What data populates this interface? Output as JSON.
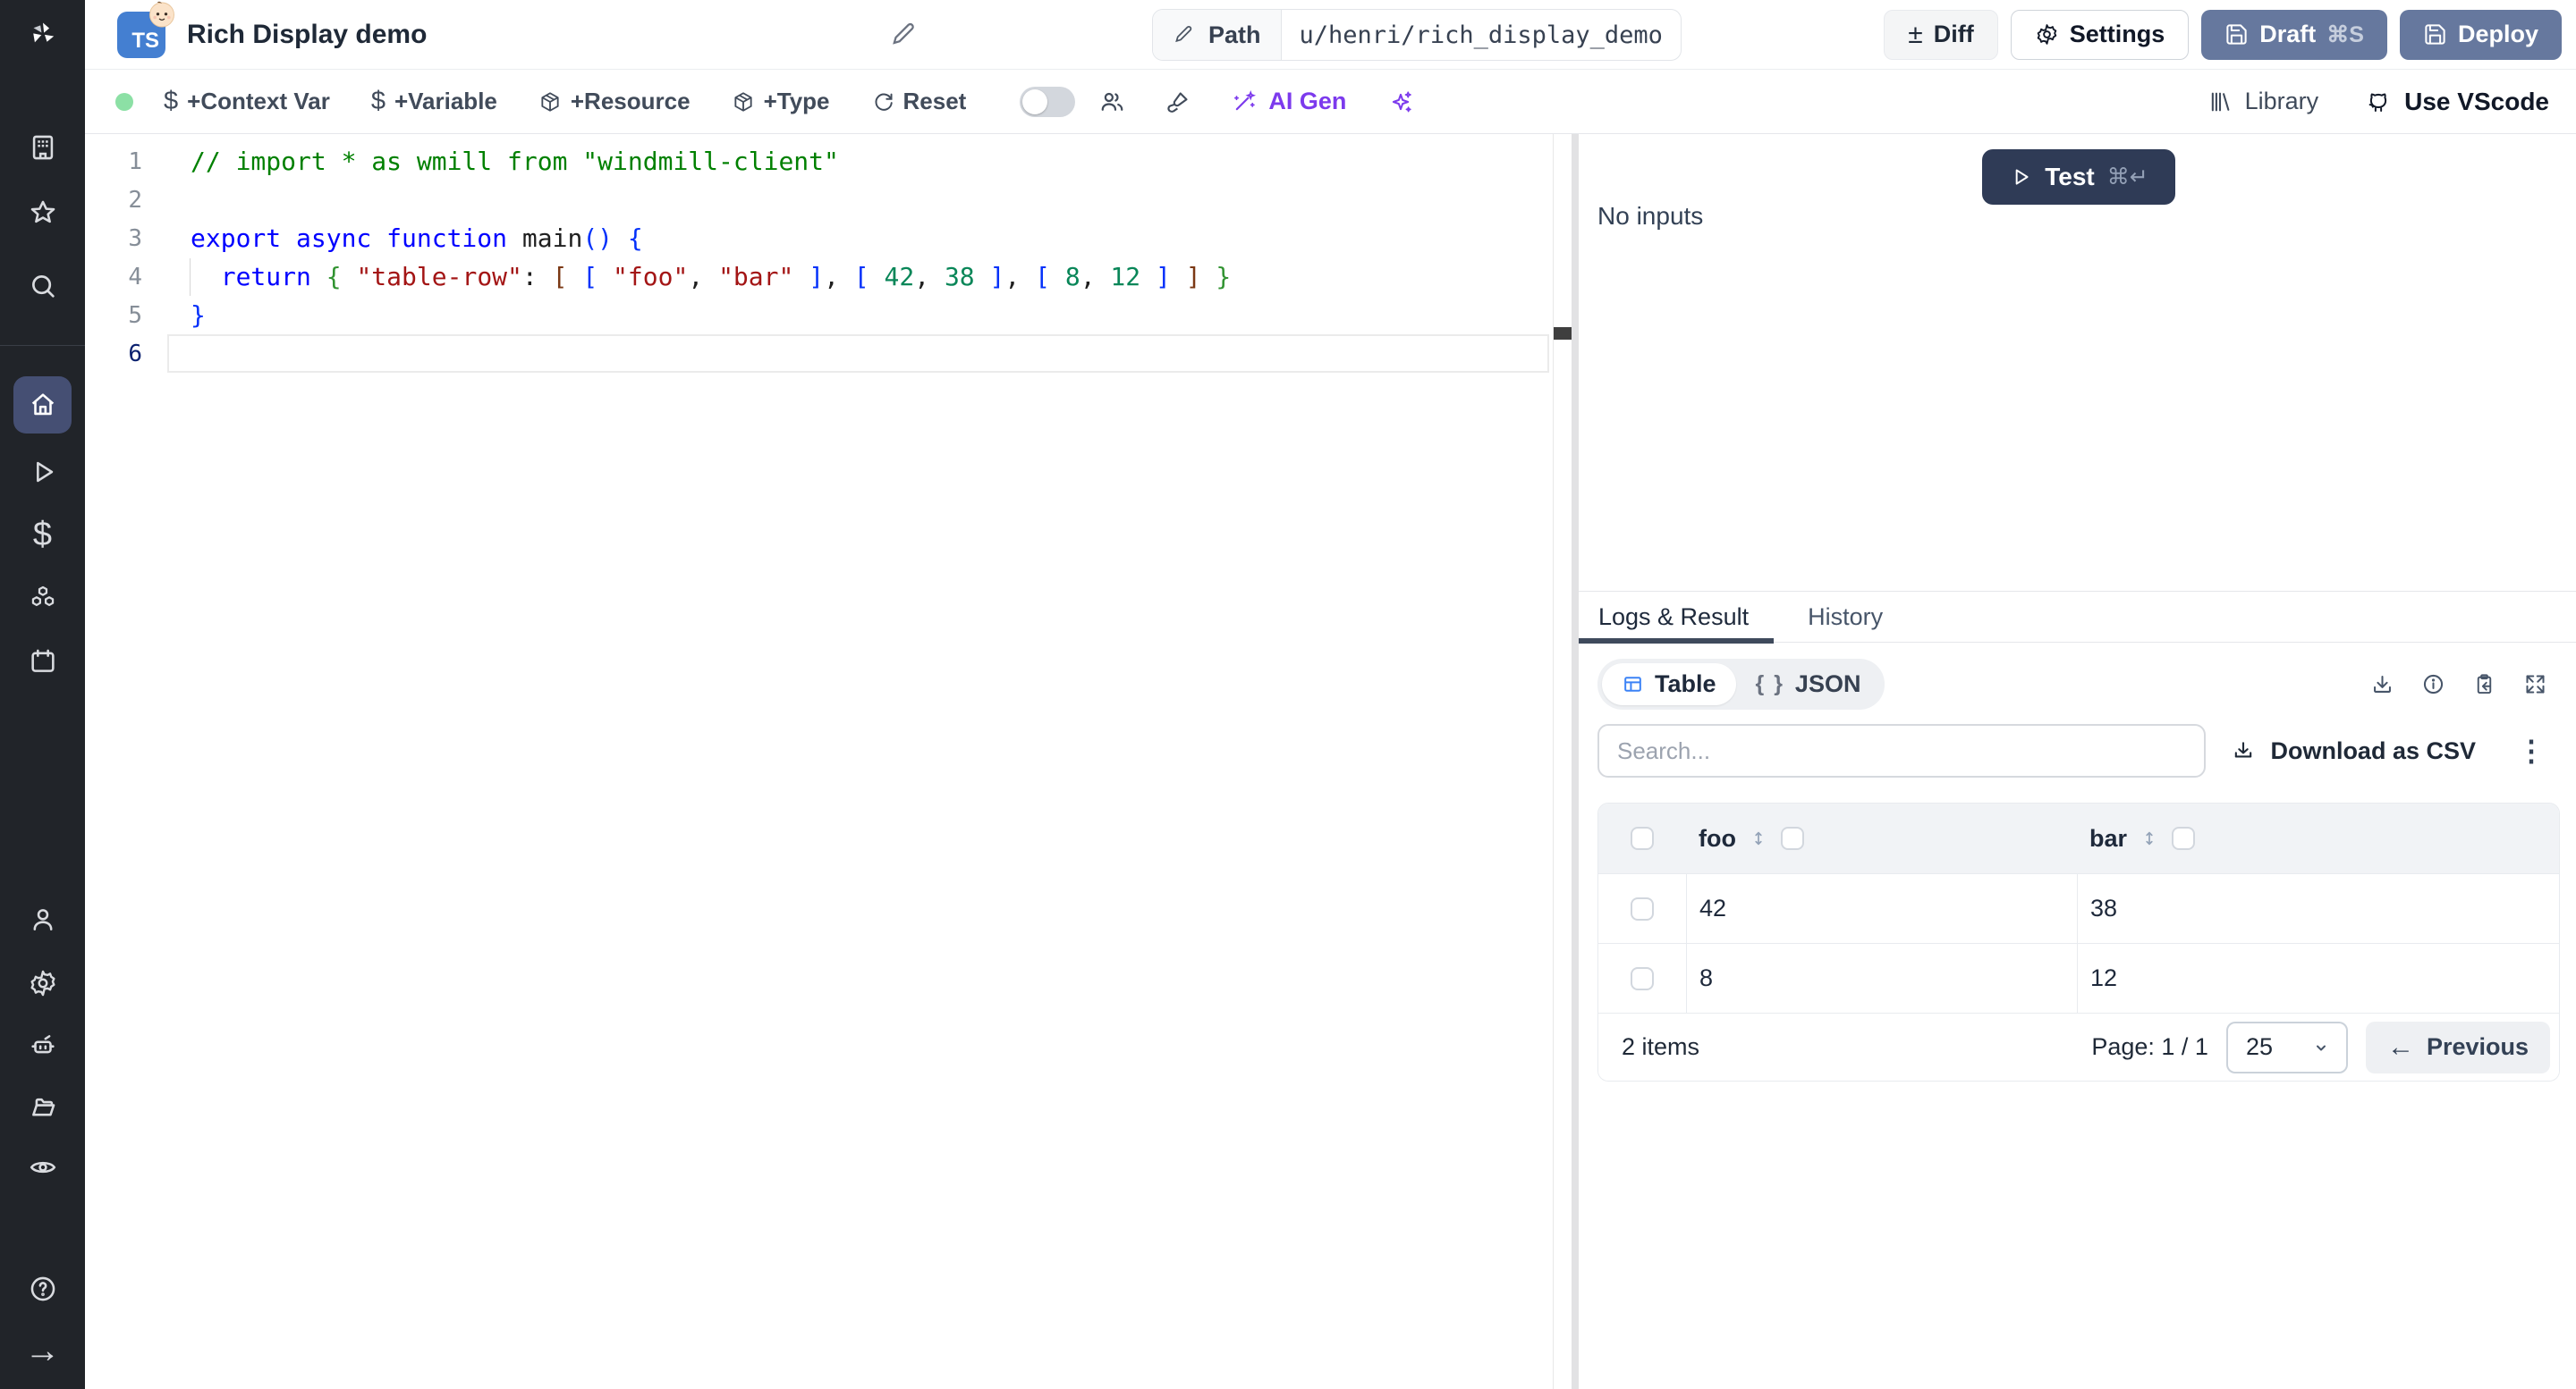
{
  "header": {
    "badge": "TS",
    "title": "Rich Display demo",
    "path_label": "Path",
    "path_value": "u/henri/rich_display_demo",
    "diff_label": "Diff",
    "diff_sign": "±",
    "settings_label": "Settings",
    "draft_label": "Draft",
    "draft_shortcut": "⌘S",
    "deploy_label": "Deploy"
  },
  "toolbar": {
    "items": [
      {
        "label": "+Context Var",
        "icon": "dollar-icon"
      },
      {
        "label": "+Variable",
        "icon": "dollar-icon"
      },
      {
        "label": "+Resource",
        "icon": "package-icon"
      },
      {
        "label": "+Type",
        "icon": "package-icon"
      },
      {
        "label": "Reset",
        "icon": "refresh-icon"
      }
    ],
    "dollar_glyph": "$",
    "ai_gen_label": "AI Gen",
    "library_label": "Library",
    "vscode_label": "Use VScode"
  },
  "sidebar": {
    "icons": [
      "windmill-logo",
      "workspace",
      "favorites",
      "search",
      "home",
      "runs",
      "variables",
      "resources",
      "schedules",
      "users",
      "settings",
      "workers",
      "folders",
      "audit-logs",
      "help",
      "expand"
    ]
  },
  "editor": {
    "active_line": 6,
    "token_colors": {
      "c": "#008000",
      "k": "#0000ff",
      "s": "#a31515",
      "n": "#098658",
      "p": "#1f1f1f",
      "f": "#1f1f1f",
      "b1": "#0431fa",
      "b2": "#319331",
      "b3": "#7b3814"
    },
    "lines": [
      {
        "n": "1",
        "t": [
          [
            "// import * as wmill from \"windmill-client\"",
            "c"
          ]
        ]
      },
      {
        "n": "2",
        "t": []
      },
      {
        "n": "3",
        "t": [
          [
            "export async function ",
            "k"
          ],
          [
            "main",
            "f"
          ],
          [
            "(",
            "b1"
          ],
          [
            ")",
            "b1"
          ],
          [
            " ",
            "p"
          ],
          [
            "{",
            "b1"
          ]
        ]
      },
      {
        "n": "4",
        "t": [
          [
            "  ",
            "p"
          ],
          [
            "return",
            "k"
          ],
          [
            " ",
            "p"
          ],
          [
            "{",
            "b2"
          ],
          [
            " ",
            "p"
          ],
          [
            "\"table-row\"",
            "s"
          ],
          [
            ":",
            "p"
          ],
          [
            " ",
            "p"
          ],
          [
            "[",
            "b3"
          ],
          [
            " ",
            "p"
          ],
          [
            "[",
            "b1"
          ],
          [
            " ",
            "p"
          ],
          [
            "\"foo\"",
            "s"
          ],
          [
            ",",
            "p"
          ],
          [
            " ",
            "p"
          ],
          [
            "\"bar\"",
            "s"
          ],
          [
            " ",
            "p"
          ],
          [
            "]",
            "b1"
          ],
          [
            ",",
            "p"
          ],
          [
            " ",
            "p"
          ],
          [
            "[",
            "b1"
          ],
          [
            " ",
            "p"
          ],
          [
            "42",
            "n"
          ],
          [
            ",",
            "p"
          ],
          [
            " ",
            "p"
          ],
          [
            "38",
            "n"
          ],
          [
            " ",
            "p"
          ],
          [
            "]",
            "b1"
          ],
          [
            ",",
            "p"
          ],
          [
            " ",
            "p"
          ],
          [
            "[",
            "b1"
          ],
          [
            " ",
            "p"
          ],
          [
            "8",
            "n"
          ],
          [
            ",",
            "p"
          ],
          [
            " ",
            "p"
          ],
          [
            "12",
            "n"
          ],
          [
            " ",
            "p"
          ],
          [
            "]",
            "b1"
          ],
          [
            " ",
            "p"
          ],
          [
            "]",
            "b3"
          ],
          [
            " ",
            "p"
          ],
          [
            "}",
            "b2"
          ]
        ]
      },
      {
        "n": "5",
        "t": [
          [
            "}",
            "b1"
          ]
        ]
      },
      {
        "n": "6",
        "t": []
      }
    ]
  },
  "run_panel": {
    "test_label": "Test",
    "test_shortcut": "⌘↵",
    "no_inputs": "No inputs",
    "tabs": [
      {
        "label": "Logs & Result",
        "active": true
      },
      {
        "label": "History",
        "active": false
      }
    ],
    "view_toggle": [
      {
        "label": "Table",
        "active": true
      },
      {
        "label": "JSON",
        "active": false,
        "glyph": "{ }"
      }
    ],
    "search_placeholder": "Search...",
    "download_csv_label": "Download as CSV",
    "kebab_glyph": "⋮",
    "table": {
      "columns": [
        "foo",
        "bar"
      ],
      "rows": [
        [
          "42",
          "38"
        ],
        [
          "8",
          "12"
        ]
      ],
      "items_label": "2 items",
      "page_label": "Page: 1 / 1",
      "page_size": "25",
      "previous_label": "Previous",
      "previous_arrow": "←"
    }
  },
  "colors": {
    "accent_slate_button": "#66789e",
    "test_button": "#2f3b56",
    "sidebar_bg": "#212429",
    "sidebar_active": "#454f73",
    "ai_purple": "#7c3aed",
    "status_green": "#8ce0a5",
    "table_icon_blue": "#3b82f6"
  }
}
